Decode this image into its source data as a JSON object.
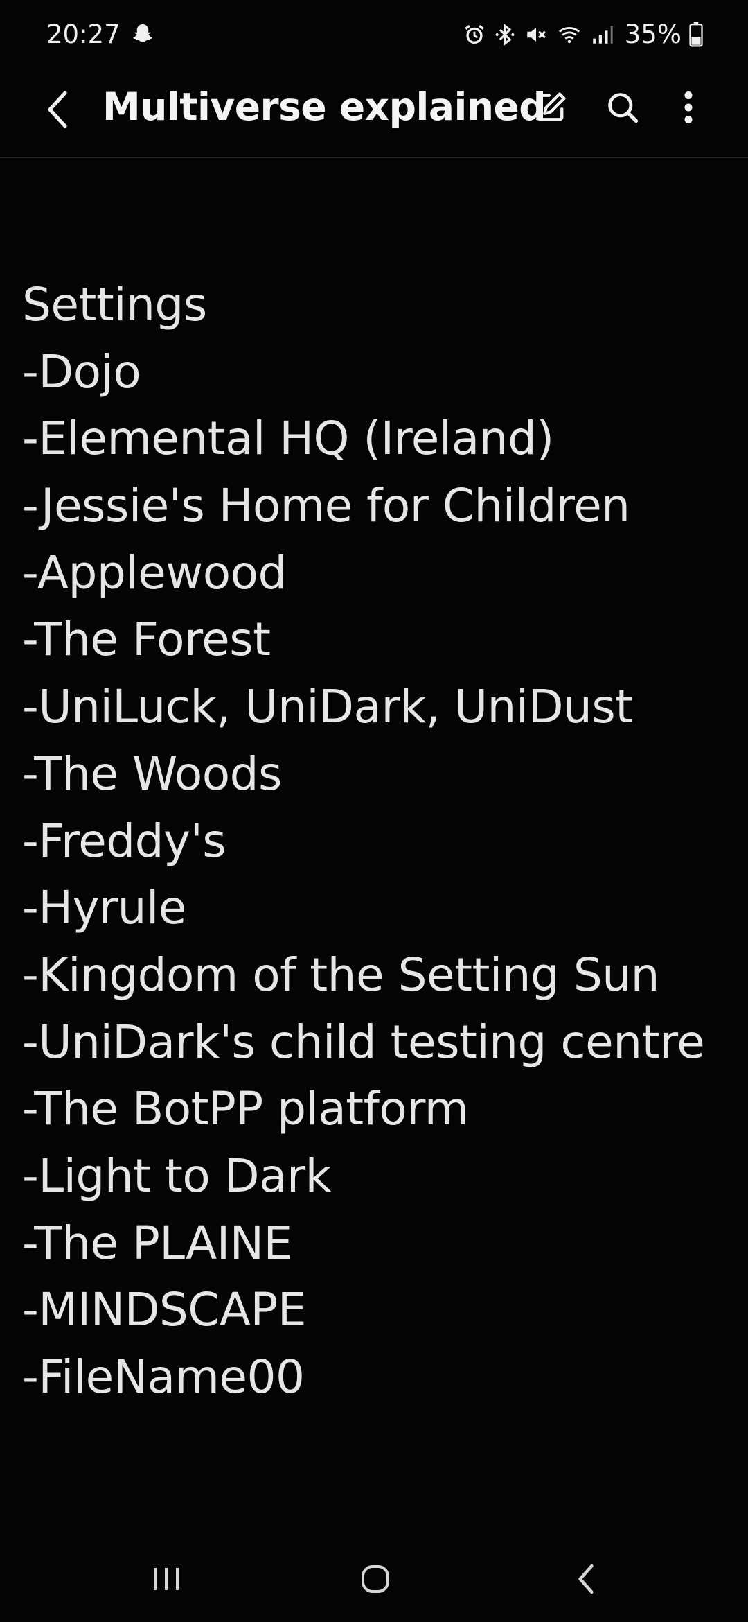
{
  "status_bar": {
    "time": "20:27",
    "battery": "35%",
    "icons": [
      "snapchat-ghost-icon",
      "alarm-icon",
      "bluetooth-icon",
      "mute-icon",
      "wifi-icon",
      "signal-icon",
      "battery-icon"
    ]
  },
  "app_bar": {
    "title": "Multiverse explained",
    "icons": [
      "back-arrow-icon",
      "edit-icon",
      "search-icon",
      "more-vert-icon"
    ]
  },
  "note": {
    "lines": [
      "Settings",
      "-Dojo",
      "-Elemental HQ (Ireland)",
      "-Jessie's Home for Children",
      "-Applewood",
      "-The Forest",
      "-UniLuck, UniDark, UniDust",
      "-The Woods",
      "-Freddy's",
      "-Hyrule",
      "-Kingdom of the Setting Sun",
      "-UniDark's child testing centre",
      "-The BotPP platform",
      "-Light to Dark",
      "-The PLAINE",
      "-MINDSCAPE",
      "-FileName00"
    ]
  },
  "nav_bar": {
    "icons": [
      "recent-apps-icon",
      "home-icon",
      "back-icon"
    ]
  },
  "colors": {
    "background": "#050505",
    "text": "#e6e6e6",
    "divider": "#2a2a2a"
  }
}
